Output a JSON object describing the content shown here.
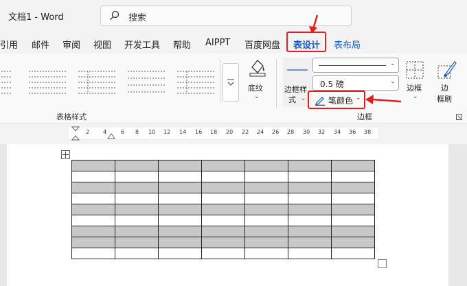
{
  "titlebar": {
    "doc_title": "文档1  -  Word",
    "search_placeholder": "搜索"
  },
  "tabs": [
    {
      "label": "引用"
    },
    {
      "label": "邮件"
    },
    {
      "label": "审阅"
    },
    {
      "label": "视图"
    },
    {
      "label": "开发工具"
    },
    {
      "label": "帮助"
    },
    {
      "label": "AIPPT"
    },
    {
      "label": "百度网盘"
    },
    {
      "label": "表设计",
      "active": true
    },
    {
      "label": "表布局"
    }
  ],
  "ribbon": {
    "table_styles_group": "表格样式",
    "shading_label": "底纹",
    "borders_group": "边框",
    "border_styles_label_line1": "边框样",
    "border_styles_label_line2": "式",
    "line_weight_value": "0.5 磅",
    "pen_color_label": "笔颜色",
    "borders_label": "边框",
    "border_painter_line1": "边",
    "border_painter_line2": "框刷"
  },
  "ruler": {
    "numbers": [
      "2",
      "4",
      "6",
      "8",
      "10",
      "12",
      "14",
      "16",
      "18",
      "20",
      "22",
      "24",
      "26",
      "28",
      "30",
      "32",
      "34",
      "36",
      "38"
    ]
  },
  "table": {
    "rows": 9,
    "cols": 7,
    "shaded_rows_in_first_col": [
      0,
      2,
      4,
      6,
      7
    ],
    "shading_color": "#c8c8c8"
  },
  "colors": {
    "accent": "#185abd",
    "highlight": "#e02020"
  }
}
